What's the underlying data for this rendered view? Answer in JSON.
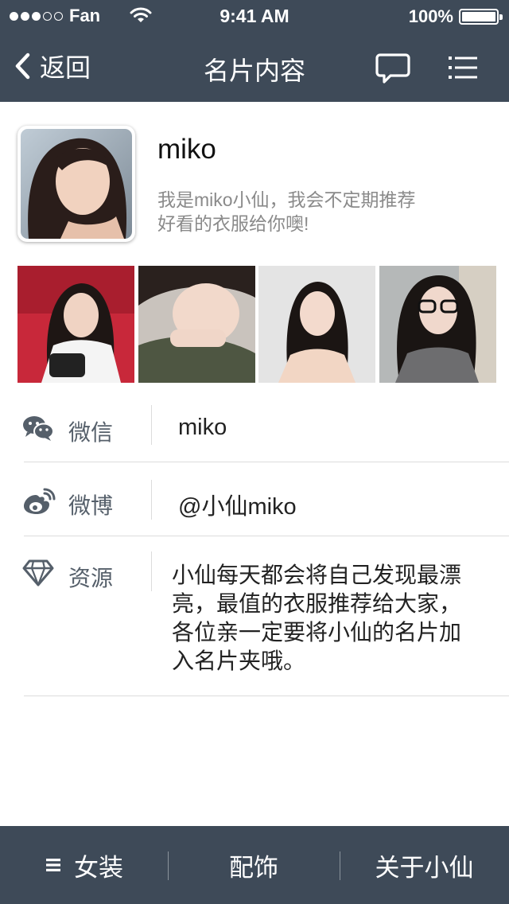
{
  "status_bar": {
    "carrier": "Fan",
    "time": "9:41 AM",
    "battery": "100%"
  },
  "nav": {
    "back_label": "返回",
    "title": "名片内容",
    "chat_icon": "speech-bubble-icon",
    "menu_icon": "list-menu-icon"
  },
  "profile": {
    "name": "miko",
    "bio_line1": "我是miko小仙，我会不定期推荐",
    "bio_line2": "好看的衣服给你噢!"
  },
  "photos": [
    {
      "name": "photo-1"
    },
    {
      "name": "photo-2"
    },
    {
      "name": "photo-3"
    },
    {
      "name": "photo-4"
    }
  ],
  "info": {
    "wechat": {
      "icon": "wechat-icon",
      "label": "微信",
      "value": "miko"
    },
    "weibo": {
      "icon": "weibo-icon",
      "label": "微博",
      "value": "@小仙miko"
    },
    "resource": {
      "icon": "diamond-icon",
      "label": "资源",
      "lines": [
        "小仙每天都会将自己发现最漂",
        "亮，最值的衣服推荐给大家，",
        "各位亲一定要将小仙的名片加",
        "入名片夹哦。"
      ]
    }
  },
  "tabbar": {
    "tab1": "女装",
    "tab2": "配饰",
    "tab3": "关于小仙"
  },
  "colors": {
    "bar": "#3e4a58",
    "divider": "#dcdcdc",
    "icon": "#555f6a",
    "bio": "#8a8a8a"
  }
}
